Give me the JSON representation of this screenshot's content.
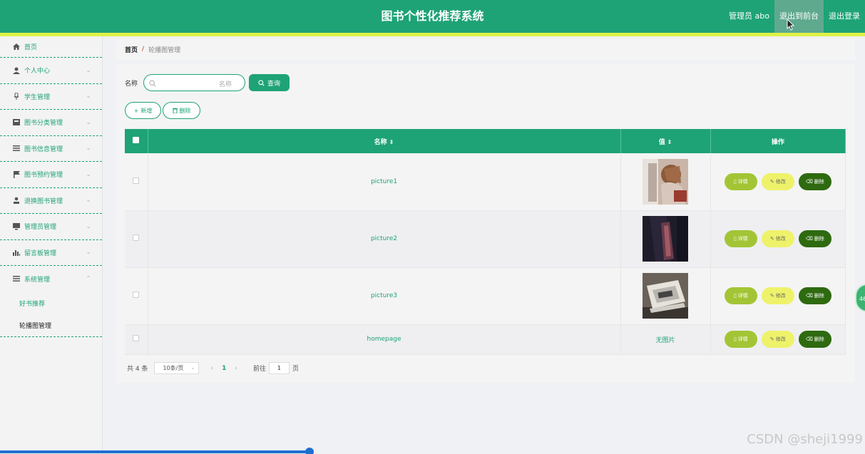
{
  "header": {
    "title": "图书个性化推荐系统",
    "admin_label": "管理员 abo",
    "front_label": "退出到前台",
    "logout_label": "退出登录"
  },
  "sidebar": {
    "home": "首页",
    "items": [
      {
        "label": "个人中心",
        "icon": "user-icon"
      },
      {
        "label": "学生管理",
        "icon": "microphone-icon"
      },
      {
        "label": "图书分类管理",
        "icon": "card-icon"
      },
      {
        "label": "图书信息管理",
        "icon": "list-icon"
      },
      {
        "label": "图书预约管理",
        "icon": "flag-icon"
      },
      {
        "label": "退换图书管理",
        "icon": "person-icon"
      },
      {
        "label": "管理员管理",
        "icon": "monitor-icon"
      },
      {
        "label": "留言板管理",
        "icon": "bar-chart-icon"
      },
      {
        "label": "系统管理",
        "icon": "list-icon"
      }
    ],
    "sub_items": [
      "好书推荐",
      "轮播图管理"
    ]
  },
  "breadcrumb": {
    "home": "首页",
    "current": "轮播图管理"
  },
  "search": {
    "label": "名称",
    "placeholder": "名称",
    "button": "查询"
  },
  "actions": {
    "add": "新增",
    "delete": "删除"
  },
  "table": {
    "columns": [
      "名称",
      "值",
      "操作"
    ],
    "rows": [
      {
        "name": "picture1",
        "value": "",
        "thumb": "photo-1"
      },
      {
        "name": "picture2",
        "value": "",
        "thumb": "photo-2"
      },
      {
        "name": "picture3",
        "value": "",
        "thumb": "photo-3"
      },
      {
        "name": "homepage",
        "value": "无图片",
        "thumb": ""
      }
    ],
    "op_labels": {
      "detail": "详情",
      "edit": "修改",
      "remove": "删除"
    }
  },
  "pagination": {
    "total": "共 4 条",
    "page_size": "10条/页",
    "current_page": "1",
    "goto_label": "前往",
    "goto_value": "1",
    "page_unit": "页"
  },
  "float_badge": "46",
  "watermark": "CSDN @sheji1999",
  "colors": {
    "primary": "#1ea376",
    "stripe": "#dff148",
    "detail": "#a3c535",
    "edit": "#eef26a",
    "remove": "#2e6a10"
  }
}
